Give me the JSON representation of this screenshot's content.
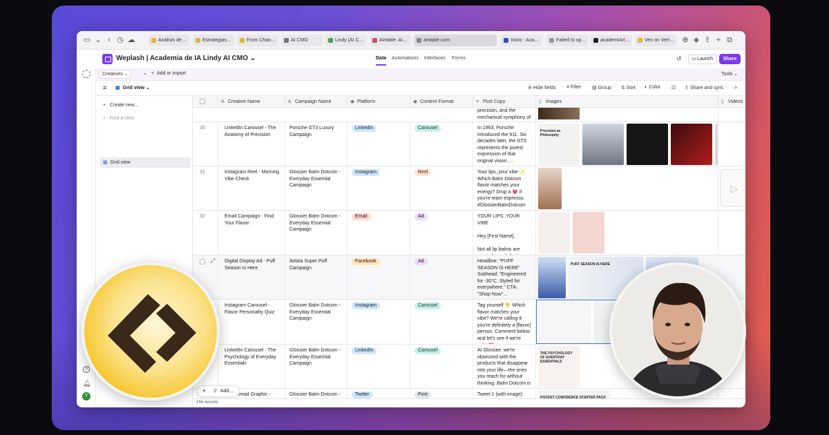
{
  "browser": {
    "tabs": [
      {
        "label": "Análisis de…",
        "color": "#e2b43a"
      },
      {
        "label": "Estrategias…",
        "color": "#e2b43a"
      },
      {
        "label": "From Chao…",
        "color": "#e2b43a"
      },
      {
        "label": "AI CMO",
        "color": "#777777"
      },
      {
        "label": "Lindy (AI C…",
        "color": "#4a9d57"
      },
      {
        "label": "Airtable: AI…",
        "color": "#d64c6b"
      },
      {
        "label": "airtable.com",
        "color": "#888888"
      },
      {
        "label": "Inicio - Aca…",
        "color": "#2f4fb3"
      },
      {
        "label": "Failed to op…",
        "color": "#999999"
      },
      {
        "label": "academIArt…",
        "color": "#222222"
      },
      {
        "label": "Veo on Vert…",
        "color": "#e2b43a"
      }
    ]
  },
  "app": {
    "base_title": "Weplash | Academia de IA Lindy AI CMO",
    "nav": [
      "Data",
      "Automations",
      "Interfaces",
      "Forms"
    ],
    "nav_active": "Data",
    "launch_label": "Launch",
    "share_label": "Share",
    "accent": "#7c3aed"
  },
  "tablebar": {
    "table_name": "Creatives",
    "add_import": "Add or import",
    "tools": "Tools"
  },
  "viewbar": {
    "view_name": "Grid view",
    "hide_fields": "Hide fields",
    "filter": "Filter",
    "group": "Group",
    "sort": "Sort",
    "color": "Color",
    "share_sync": "Share and sync"
  },
  "sidebar": {
    "create_new": "Create new...",
    "find_view": "Find a view",
    "grid_view": "Grid view"
  },
  "columns": [
    "Creative Name",
    "Campaign Name",
    "Platform",
    "Content Format",
    "Post Copy",
    "Images",
    "Videos"
  ],
  "top_partial_copy": "precision, and the mechanical symphony of …",
  "rows": [
    {
      "num": "30",
      "name": "LinkedIn Carousel - The Anatomy of Precision",
      "campaign": "Porsche GT3 Luxury Campaign",
      "platform": "LinkedIn",
      "platform_class": "li",
      "format": "Carousel",
      "format_class": "car",
      "copy": "In 1963, Porsche introduced the 911. Six decades later, the GT3 represents the purest expression of that original vision…."
    },
    {
      "num": "31",
      "name": "Instagram Reel - Morning Vibe Check",
      "campaign": "Glossier Balm Dotcom - Everyday Essential Campaign",
      "platform": "Instagram",
      "platform_class": "ig",
      "format": "Reel",
      "format_class": "reel",
      "copy": "Your lips, your vibe ✨ Which Balm Dotcom flavor matches your energy? Drop a 💗 if you're team espresso. #GlossierBalmDotcom …"
    },
    {
      "num": "32",
      "name": "Email Campaign - Find Your Flavor",
      "campaign": "Glossier Balm Dotcom - Everyday Essential Campaign",
      "platform": "Email",
      "platform_class": "em",
      "format": "Ad",
      "format_class": "ad",
      "copy": "YOUR LIPS, YOUR VIBE\n\nHey [First Name],\n\nNot all lip balms are created equal. And …"
    },
    {
      "num": "",
      "name": "Digital Display Ad - Puff Season Is Here",
      "campaign": "Aritzia Super Puff Campaign",
      "platform": "Facebook",
      "platform_class": "fb",
      "format": "Ad",
      "format_class": "ad",
      "copy": "Headline: \"PUFF SEASON IS HERE\" Subhead: \"Engineered for -30°C. Styled for everywhere.\" CTA: \"Shop Now\"…"
    },
    {
      "num": "",
      "name": "Instagram Carousel - Flavor Personality Quiz",
      "campaign": "Glossier Balm Dotcom - Everyday Essential Campaign",
      "platform": "Instagram",
      "platform_class": "ig",
      "format": "Carousel",
      "format_class": "car",
      "copy": "Tag yourself 👇 Which flavor matches your vibe? We're calling it: you're definitely a [flavor] person. Comment below and let's see if we're right 💗 …"
    },
    {
      "num": "",
      "name": "LinkedIn Carousel - The Psychology of Everyday Essentials",
      "campaign": "Glossier Balm Dotcom - Everyday Essential Campaign",
      "platform": "LinkedIn",
      "platform_class": "li",
      "format": "Carousel",
      "format_class": "car",
      "copy": "At Glossier, we're obsessed with the products that disappear into your life—the ones you reach for without thinking. Balm Dotcom is our love letter t…"
    },
    {
      "num": "",
      "name": "…X Thread Graphic -",
      "campaign": "Glossier Balm Dotcom -",
      "platform": "Twitter",
      "platform_class": "tw",
      "format": "Post",
      "format_class": "post",
      "copy": "Tweet 1 (with image):"
    }
  ],
  "image_captions": {
    "precision": "Precision as Philosophy",
    "puff": "PUFF SEASON IS HERE",
    "psychology": "THE PSYCHOLOGY OF EVERYDAY ESSENTIALS",
    "pocket": "POCKET CONFIDENCE STARTER PACK"
  },
  "footer": {
    "records": "146 records",
    "add_label": "Add..."
  }
}
